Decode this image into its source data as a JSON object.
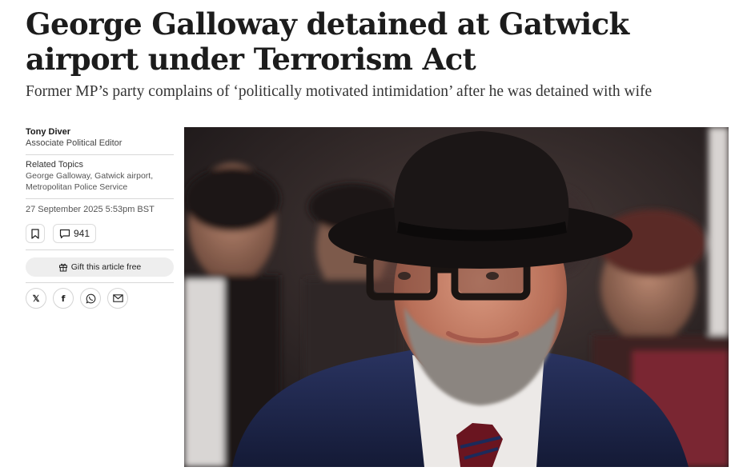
{
  "article": {
    "headline": "George Galloway detained at Gatwick airport under Terrorism Act",
    "standfirst": "Former MP’s party complains of ‘politically motivated intimidation’ after he was detained with wife"
  },
  "byline": {
    "author": "Tony Diver",
    "role": "Associate Political Editor"
  },
  "topics": {
    "label": "Related Topics",
    "items": "George Galloway, Gatwick airport, Metropolitan Police Service"
  },
  "published": "27 September 2025 5:53pm BST",
  "actions": {
    "bookmark_icon": "bookmark-icon",
    "comment_icon": "comment-icon",
    "comment_count": "941",
    "gift_icon": "gift-icon",
    "gift_label": "Gift this article free"
  },
  "share": {
    "icons": [
      "x-icon",
      "facebook-icon",
      "whatsapp-icon",
      "email-icon"
    ],
    "x_glyph": "𝕏",
    "facebook_glyph": "f"
  },
  "photo": {
    "subject": "man-in-black-fedora-and-glasses-photo"
  }
}
